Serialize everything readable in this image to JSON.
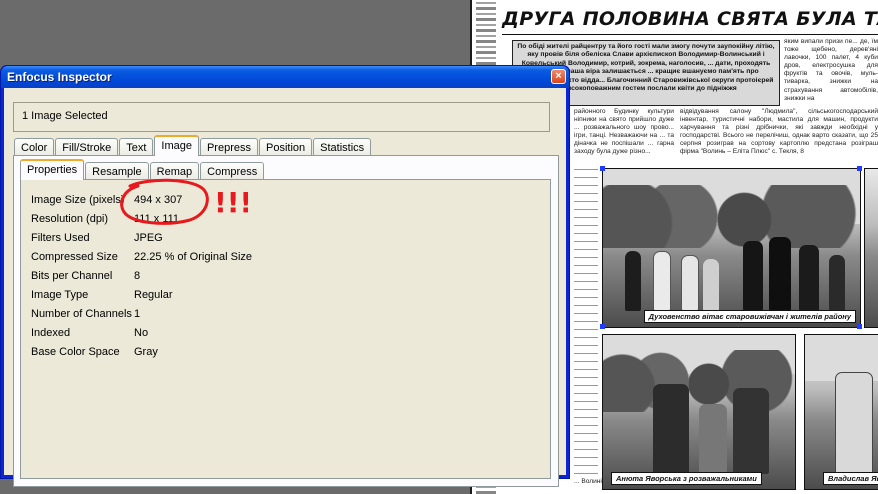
{
  "newspaper": {
    "headline": "ДРУГА ПОЛОВИНА СВЯТА БУЛА ТАК",
    "lead": "По обіді жителі райцентру та його гості мали змогу почути заупо­кійну літію, яку провів біля обеліска Слави архієпископ Володимир-Волинський і Ковельський Володимир, котрий, зокрема, наголосив, ... дати, проходять роки, але наша віра залишається ... кращиє вшануємо пам'ять про загиблих, тих, хто відда... Благочинний Старовижівської округи протоієрей ... високоповажним гостем послали квіти до підніжжя",
    "col_right_top": "яким випали призи пе... де, їм тоже щебено, дерев'яні лавочки, 100 палет, 4 куби дров, електросушка для фруктів та овочів, муль­тиварка, знижки на страхування авто­мобілів, знижки на",
    "col_mid": "відвідування салону \"Людмила\", сільськогосподарський інвентар, туристичні набори, мастила для машин, про­дукти харчування та різні дрібнички, які завжди необхідні у господарстві. Всього не перелічиш, однак варто сказа­ти, що 25 серпня розиграв на сортову картоплю предста­на розіграш фірма \"Волинь – Еліта Плюс\" с. Текля, 8",
    "col_left": "районного Будинку культури ніпники на свято прийшло дуже ... розважального шоу прово­... ігри, танці. Незважаючи на ... та діначка не поспішали ... гарна заходу була дуже різно­...",
    "col_left_bottom": "... Волині\" Денис П'ятиго­",
    "caption_1": "Духовенство вітає старовижівчан і жителів району",
    "caption_2": "Анюта Яворська з розважальниками",
    "caption_3": "Владислав Яворс"
  },
  "inspector": {
    "title": "Enfocus Inspector",
    "close_label": "×",
    "selection_label": "1 Image Selected",
    "tabs": [
      "Color",
      "Fill/Stroke",
      "Text",
      "Image",
      "Prepress",
      "Position",
      "Statistics"
    ],
    "active_tab": "Image",
    "subtabs": [
      "Properties",
      "Resample",
      "Remap",
      "Compress"
    ],
    "active_subtab": "Properties",
    "properties": [
      {
        "key": "Image Size (pixels)",
        "value": "494 x 307"
      },
      {
        "key": "Resolution (dpi)",
        "value": "111 x 111"
      },
      {
        "key": "Filters Used",
        "value": "JPEG"
      },
      {
        "key": "Compressed Size",
        "value": "22.25 % of Original Size"
      },
      {
        "key": "Bits per Channel",
        "value": "8"
      },
      {
        "key": "Image Type",
        "value": "Regular"
      },
      {
        "key": "Number of Channels",
        "value": "1"
      },
      {
        "key": "Indexed",
        "value": "No"
      },
      {
        "key": "Base Color Space",
        "value": "Gray"
      }
    ]
  },
  "annotation": {
    "mark": "!!!",
    "color": "#e8191d"
  },
  "colors": {
    "titlebar": "#0a5be0",
    "window_bg": "#ece9d8",
    "desktop": "#6b6b6b",
    "tab_highlight": "#f1a92c",
    "selection_handles": "#1f3cff"
  }
}
